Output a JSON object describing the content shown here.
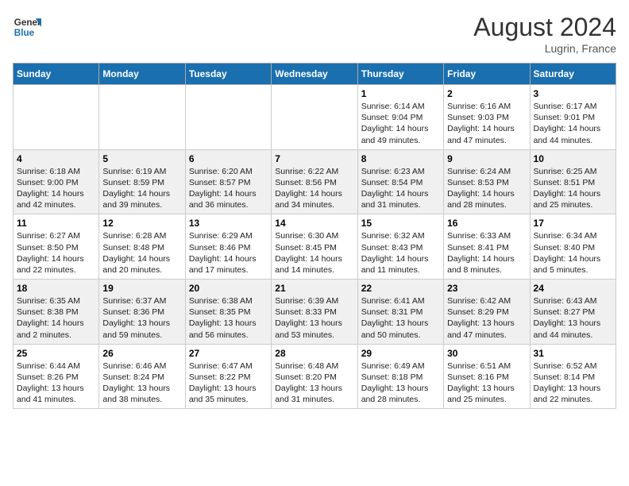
{
  "header": {
    "logo_general": "General",
    "logo_blue": "Blue",
    "month_year": "August 2024",
    "location": "Lugrin, France"
  },
  "weekdays": [
    "Sunday",
    "Monday",
    "Tuesday",
    "Wednesday",
    "Thursday",
    "Friday",
    "Saturday"
  ],
  "weeks": [
    [
      {
        "day": "",
        "info": ""
      },
      {
        "day": "",
        "info": ""
      },
      {
        "day": "",
        "info": ""
      },
      {
        "day": "",
        "info": ""
      },
      {
        "day": "1",
        "info": "Sunrise: 6:14 AM\nSunset: 9:04 PM\nDaylight: 14 hours\nand 49 minutes."
      },
      {
        "day": "2",
        "info": "Sunrise: 6:16 AM\nSunset: 9:03 PM\nDaylight: 14 hours\nand 47 minutes."
      },
      {
        "day": "3",
        "info": "Sunrise: 6:17 AM\nSunset: 9:01 PM\nDaylight: 14 hours\nand 44 minutes."
      }
    ],
    [
      {
        "day": "4",
        "info": "Sunrise: 6:18 AM\nSunset: 9:00 PM\nDaylight: 14 hours\nand 42 minutes."
      },
      {
        "day": "5",
        "info": "Sunrise: 6:19 AM\nSunset: 8:59 PM\nDaylight: 14 hours\nand 39 minutes."
      },
      {
        "day": "6",
        "info": "Sunrise: 6:20 AM\nSunset: 8:57 PM\nDaylight: 14 hours\nand 36 minutes."
      },
      {
        "day": "7",
        "info": "Sunrise: 6:22 AM\nSunset: 8:56 PM\nDaylight: 14 hours\nand 34 minutes."
      },
      {
        "day": "8",
        "info": "Sunrise: 6:23 AM\nSunset: 8:54 PM\nDaylight: 14 hours\nand 31 minutes."
      },
      {
        "day": "9",
        "info": "Sunrise: 6:24 AM\nSunset: 8:53 PM\nDaylight: 14 hours\nand 28 minutes."
      },
      {
        "day": "10",
        "info": "Sunrise: 6:25 AM\nSunset: 8:51 PM\nDaylight: 14 hours\nand 25 minutes."
      }
    ],
    [
      {
        "day": "11",
        "info": "Sunrise: 6:27 AM\nSunset: 8:50 PM\nDaylight: 14 hours\nand 22 minutes."
      },
      {
        "day": "12",
        "info": "Sunrise: 6:28 AM\nSunset: 8:48 PM\nDaylight: 14 hours\nand 20 minutes."
      },
      {
        "day": "13",
        "info": "Sunrise: 6:29 AM\nSunset: 8:46 PM\nDaylight: 14 hours\nand 17 minutes."
      },
      {
        "day": "14",
        "info": "Sunrise: 6:30 AM\nSunset: 8:45 PM\nDaylight: 14 hours\nand 14 minutes."
      },
      {
        "day": "15",
        "info": "Sunrise: 6:32 AM\nSunset: 8:43 PM\nDaylight: 14 hours\nand 11 minutes."
      },
      {
        "day": "16",
        "info": "Sunrise: 6:33 AM\nSunset: 8:41 PM\nDaylight: 14 hours\nand 8 minutes."
      },
      {
        "day": "17",
        "info": "Sunrise: 6:34 AM\nSunset: 8:40 PM\nDaylight: 14 hours\nand 5 minutes."
      }
    ],
    [
      {
        "day": "18",
        "info": "Sunrise: 6:35 AM\nSunset: 8:38 PM\nDaylight: 14 hours\nand 2 minutes."
      },
      {
        "day": "19",
        "info": "Sunrise: 6:37 AM\nSunset: 8:36 PM\nDaylight: 13 hours\nand 59 minutes."
      },
      {
        "day": "20",
        "info": "Sunrise: 6:38 AM\nSunset: 8:35 PM\nDaylight: 13 hours\nand 56 minutes."
      },
      {
        "day": "21",
        "info": "Sunrise: 6:39 AM\nSunset: 8:33 PM\nDaylight: 13 hours\nand 53 minutes."
      },
      {
        "day": "22",
        "info": "Sunrise: 6:41 AM\nSunset: 8:31 PM\nDaylight: 13 hours\nand 50 minutes."
      },
      {
        "day": "23",
        "info": "Sunrise: 6:42 AM\nSunset: 8:29 PM\nDaylight: 13 hours\nand 47 minutes."
      },
      {
        "day": "24",
        "info": "Sunrise: 6:43 AM\nSunset: 8:27 PM\nDaylight: 13 hours\nand 44 minutes."
      }
    ],
    [
      {
        "day": "25",
        "info": "Sunrise: 6:44 AM\nSunset: 8:26 PM\nDaylight: 13 hours\nand 41 minutes."
      },
      {
        "day": "26",
        "info": "Sunrise: 6:46 AM\nSunset: 8:24 PM\nDaylight: 13 hours\nand 38 minutes."
      },
      {
        "day": "27",
        "info": "Sunrise: 6:47 AM\nSunset: 8:22 PM\nDaylight: 13 hours\nand 35 minutes."
      },
      {
        "day": "28",
        "info": "Sunrise: 6:48 AM\nSunset: 8:20 PM\nDaylight: 13 hours\nand 31 minutes."
      },
      {
        "day": "29",
        "info": "Sunrise: 6:49 AM\nSunset: 8:18 PM\nDaylight: 13 hours\nand 28 minutes."
      },
      {
        "day": "30",
        "info": "Sunrise: 6:51 AM\nSunset: 8:16 PM\nDaylight: 13 hours\nand 25 minutes."
      },
      {
        "day": "31",
        "info": "Sunrise: 6:52 AM\nSunset: 8:14 PM\nDaylight: 13 hours\nand 22 minutes."
      }
    ]
  ]
}
